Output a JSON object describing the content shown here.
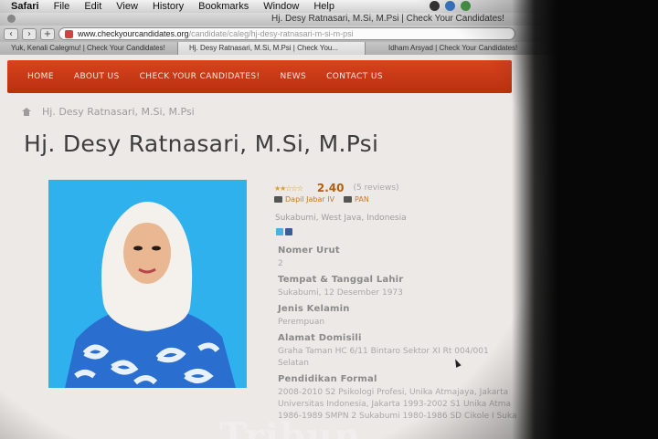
{
  "menubar": {
    "app": "Safari",
    "items": [
      "File",
      "Edit",
      "View",
      "History",
      "Bookmarks",
      "Window",
      "Help"
    ]
  },
  "window": {
    "title": "Hj. Desy Ratnasari, M.Si, M.Psi | Check Your Candidates!"
  },
  "address_bar": {
    "url_domain": "www.checkyourcandidates.org",
    "url_path": "/candidate/caleg/hj-desy-ratnasari-m-si-m-psi"
  },
  "tabs": [
    {
      "label": "Yuk, Kenali Calegmu! | Check Your Candidates!",
      "active": false
    },
    {
      "label": "Hj. Desy Ratnasari, M.Si, M.Psi | Check You...",
      "active": true
    },
    {
      "label": "Idham Arsyad | Check Your Candidates!",
      "active": false
    }
  ],
  "nav": [
    "HOME",
    "ABOUT US",
    "CHECK YOUR CANDIDATES!",
    "NEWS",
    "CONTACT US"
  ],
  "breadcrumb": "Hj. Desy Ratnasari, M.Si, M.Psi",
  "page_title": "Hj. Desy Ratnasari, M.Si, M.Psi",
  "rating": {
    "value": 2.4,
    "max": 5,
    "score_text": "2.40",
    "reviews_text": "(5 reviews)"
  },
  "tags": {
    "dapil": "Dapil Jabar IV",
    "party": "PAN"
  },
  "location": "Sukabumi, West Java, Indonesia",
  "fields": [
    {
      "label": "Nomer Urut",
      "value": "2"
    },
    {
      "label": "Tempat & Tanggal Lahir",
      "value": "Sukabumi, 12 Desember 1973"
    },
    {
      "label": "Jenis Kelamin",
      "value": "Perempuan"
    },
    {
      "label": "Alamat Domisili",
      "value": "Graha Taman HC 6/11 Bintaro Sektor XI Rt 004/001",
      "value2": "Selatan"
    },
    {
      "label": "Pendidikan Formal",
      "value": "2008-2010 S2 Psikologi Profesi, Unika Atmajaya, Jakarta",
      "value2": "Universitas Indonesia, Jakarta 1993-2002 S1 Unika Atma",
      "value3": "1986-1989 SMPN 2 Sukabumi 1980-1986 SD Cikole I Suka"
    }
  ],
  "colors": {
    "nav_bg": "#c5391a",
    "photo_bg": "#2fb1ee",
    "score": "#b35e0a"
  },
  "watermark": "Tribun"
}
